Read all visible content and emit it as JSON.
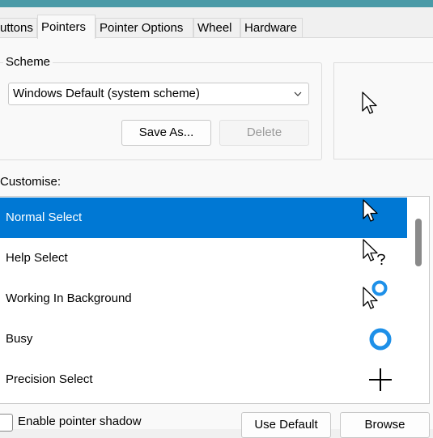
{
  "tabs": [
    {
      "label": "uttons",
      "active": false
    },
    {
      "label": "Pointers",
      "active": true
    },
    {
      "label": "Pointer Options",
      "active": false
    },
    {
      "label": "Wheel",
      "active": false
    },
    {
      "label": "Hardware",
      "active": false
    }
  ],
  "scheme": {
    "legend": "Scheme",
    "selected": "Windows Default (system scheme)",
    "save_as_label": "Save As...",
    "delete_label": "Delete"
  },
  "preview": {
    "cursor_icon": "arrow-cursor-icon"
  },
  "customise": {
    "label": "Customise:",
    "items": [
      {
        "label": "Normal Select",
        "icon": "arrow-cursor-icon",
        "selected": true
      },
      {
        "label": "Help Select",
        "icon": "help-cursor-icon",
        "selected": false
      },
      {
        "label": "Working In Background",
        "icon": "working-cursor-icon",
        "selected": false
      },
      {
        "label": "Busy",
        "icon": "busy-ring-icon",
        "selected": false
      },
      {
        "label": "Precision Select",
        "icon": "crosshair-icon",
        "selected": false
      }
    ]
  },
  "footer": {
    "shadow_label": "Enable pointer shadow",
    "shadow_checked": false,
    "use_default_label": "Use Default",
    "browse_label": "Browse"
  },
  "colors": {
    "selection": "#0078d4",
    "busy_ring": "#1e90e8",
    "title_strip": "#4a9aa7"
  }
}
